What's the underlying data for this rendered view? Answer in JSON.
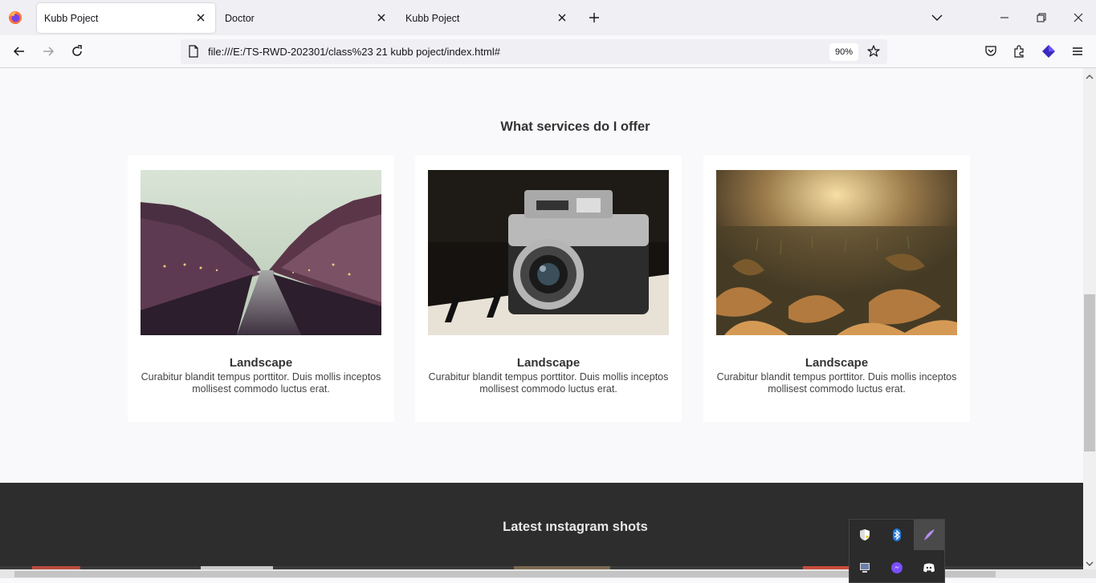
{
  "browser": {
    "tabs": [
      {
        "title": "Kubb Poject",
        "active": true
      },
      {
        "title": "Doctor",
        "active": false
      },
      {
        "title": "Kubb Poject",
        "active": false
      }
    ],
    "url": "file:///E:/TS-RWD-202301/class%23 21 kubb poject/index.html#",
    "zoom": "90%"
  },
  "page": {
    "services_title": "What services do I offer",
    "cards": [
      {
        "image": "city-canal-photo",
        "title": "Landscape",
        "text": "Curabitur blandit tempus porttitor. Duis mollis inceptos mollisest commodo luctus erat."
      },
      {
        "image": "vintage-camera-photo",
        "title": "Landscape",
        "text": "Curabitur blandit tempus porttitor. Duis mollis inceptos mollisest commodo luctus erat."
      },
      {
        "image": "autumn-leaves-photo",
        "title": "Landscape",
        "text": "Curabitur blandit tempus porttitor. Duis mollis inceptos mollisest commodo luctus erat."
      }
    ],
    "instagram_title": "Latest ınstagram shots"
  },
  "tray": {
    "icons": [
      "security-shield-icon",
      "bluetooth-icon",
      "feather-app-icon",
      "display-icon",
      "messenger-icon",
      "discord-icon"
    ]
  },
  "colors": {
    "page_bg": "#f9f9fb",
    "card_bg": "#ffffff",
    "dark_section": "#2d2d2d",
    "heading": "#333333"
  }
}
